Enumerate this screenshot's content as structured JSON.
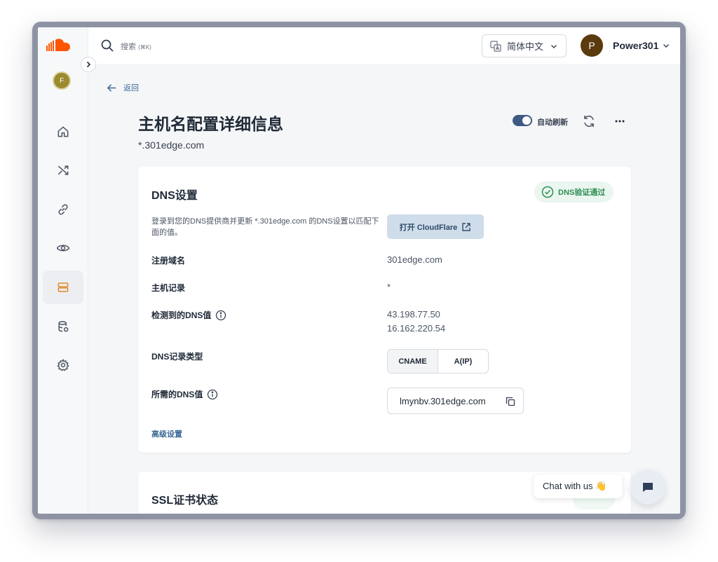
{
  "sidebar": {
    "workspace_initial": "F",
    "nav": [
      {
        "name": "home-icon"
      },
      {
        "name": "shuffle-icon"
      },
      {
        "name": "link-icon"
      },
      {
        "name": "eye-icon"
      },
      {
        "name": "server-icon",
        "active": true
      },
      {
        "name": "database-icon"
      },
      {
        "name": "gear-icon"
      }
    ]
  },
  "topbar": {
    "search_placeholder": "搜索",
    "search_shortcut": "(⌘K)",
    "language": "简体中文",
    "user_initial": "P",
    "user_name": "Power301"
  },
  "page": {
    "back_label": "返回",
    "title": "主机名配置详细信息",
    "subtitle": "*.301edge.com",
    "auto_refresh_label": "自动刷新",
    "auto_refresh_on": true
  },
  "dns_card": {
    "title": "DNS设置",
    "status_badge": "DNS验证通过",
    "description": "登录到您的DNS提供商并更新 *.301edge.com 的DNS设置以匹配下面的值。",
    "cloudflare_button": "打开 CloudFlare",
    "rows": {
      "domain_label": "注册域名",
      "domain_value": "301edge.com",
      "host_label": "主机记录",
      "host_value": "*",
      "detected_label": "检测到的DNS值",
      "detected_values": [
        "43.198.77.50",
        "16.162.220.54"
      ],
      "type_label": "DNS记录类型",
      "type_options": [
        "CNAME",
        "A(IP)"
      ],
      "type_selected": "CNAME",
      "required_label": "所需的DNS值",
      "required_value": "lmynbv.301edge.com"
    },
    "advanced_link": "高级设置"
  },
  "ssl_card": {
    "title": "SSL证书状态"
  },
  "chat": {
    "bubble_text": "Chat with us 👋"
  },
  "colors": {
    "accent": "#3d5a84",
    "success": "#2f8f55",
    "link": "#3b6a98"
  }
}
